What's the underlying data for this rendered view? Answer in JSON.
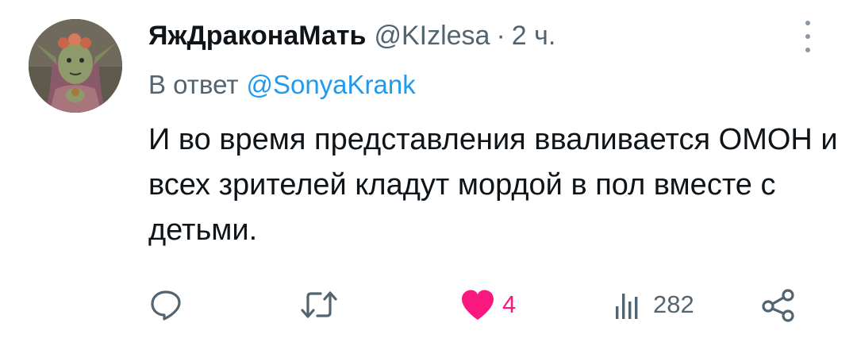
{
  "tweet": {
    "display_name": "ЯжДраконаМать",
    "handle": "@KIzlesa",
    "separator": "·",
    "time": "2 ч.",
    "reply_prefix": "В ответ",
    "reply_mention": "@SonyaKrank",
    "text": "И во время представления вваливается ОМОН и всех зрителей кладут мордой в пол вместе с детьми."
  },
  "actions": {
    "reply": {
      "icon": "reply-icon"
    },
    "retweet": {
      "icon": "retweet-icon"
    },
    "like": {
      "icon": "heart-icon",
      "count": "4",
      "liked": true
    },
    "views": {
      "icon": "views-chart-icon",
      "count": "282"
    },
    "share": {
      "icon": "share-icon"
    }
  },
  "colors": {
    "text": "#0f1419",
    "secondary": "#536471",
    "link": "#1d9bf0",
    "like": "#f91880"
  }
}
